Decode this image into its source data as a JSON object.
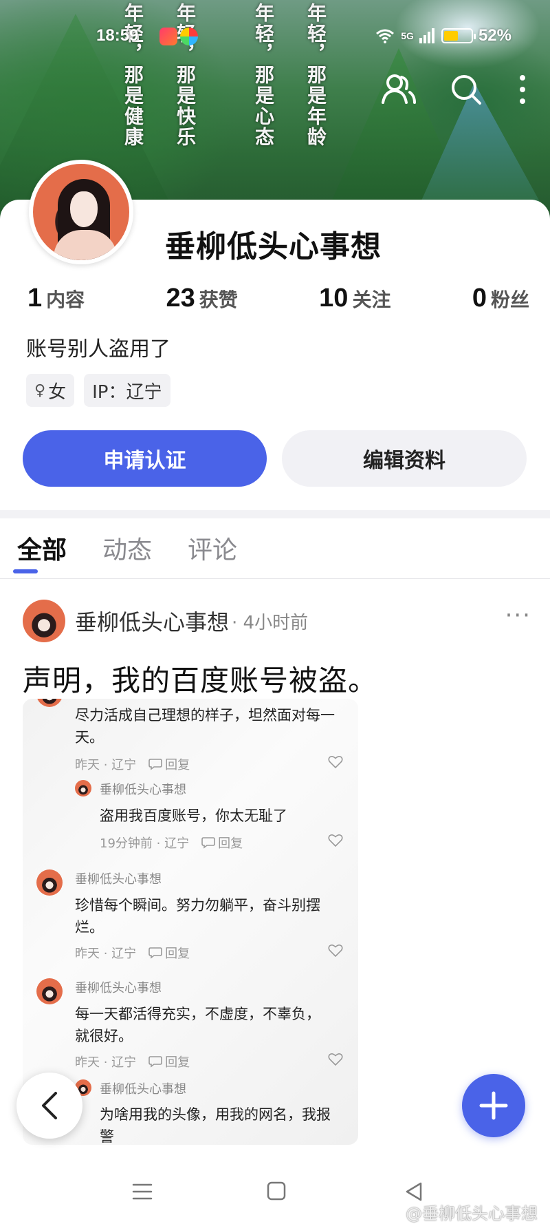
{
  "banner": {
    "poem_columns": [
      "年轻，那是健康",
      "年轻，那是快乐",
      "年轻，那是心态",
      "年轻，那是年龄"
    ]
  },
  "status_bar": {
    "time": "18:59",
    "network": "5G",
    "battery": "52%",
    "battery_level": 0.52
  },
  "top_icons": [
    "friends-icon",
    "search-icon",
    "more-vertical-icon"
  ],
  "profile": {
    "username": "垂柳低头心事想",
    "stats": [
      {
        "num": "1",
        "label": "内容"
      },
      {
        "num": "23",
        "label": "获赞"
      },
      {
        "num": "10",
        "label": "关注"
      },
      {
        "num": "0",
        "label": "粉丝"
      }
    ],
    "bio": "账号别人盗用了",
    "gender_symbol": "♀",
    "gender": "女",
    "ip": "IP：辽宁",
    "btn_certify": "申请认证",
    "btn_edit": "编辑资料"
  },
  "tabs": [
    "全部",
    "动态",
    "评论"
  ],
  "post": {
    "author": "垂柳低头心事想",
    "time": "· 4小时前",
    "more": "···",
    "title": "声明，我的百度账号被盗。",
    "screenshot": {
      "c1_text": "尽力活成自己理想的样子，坦然面对每一天。",
      "c1_when": "昨天 · 辽宁",
      "reply_label": "回复",
      "c2_name": "垂柳低头心事想",
      "c2_text": "盗用我百度账号，你太无耻了",
      "c2_when": "19分钟前 · 辽宁",
      "c3_name": "垂柳低头心事想",
      "c3_text": "珍惜每个瞬间。努力勿躺平，奋斗别摆烂。",
      "c3_when": "昨天 · 辽宁",
      "c4_name": "垂柳低头心事想",
      "c4_text": "每一天都活得充实，不虚度，不辜负，就很好。",
      "c4_when": "昨天 · 辽宁",
      "c5_name": "垂柳低头心事想",
      "c5_text": "为啥用我的头像，用我的网名，我报警"
    }
  },
  "watermark": "@垂柳低头心事想",
  "colors": {
    "accent": "#4a63e8",
    "secondary_bg": "#f1f1f5"
  }
}
